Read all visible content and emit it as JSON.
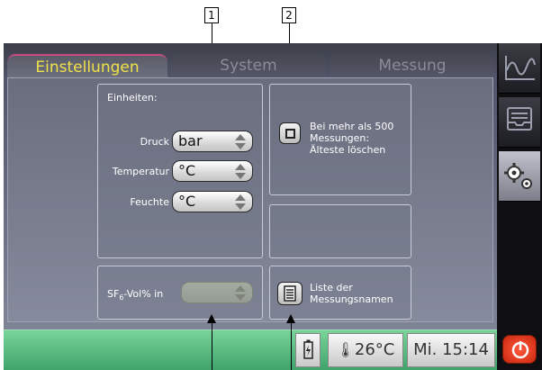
{
  "callouts": [
    "1",
    "2"
  ],
  "tabs": {
    "einstellungen": "Einstellungen",
    "system": "System",
    "messung": "Messung"
  },
  "units": {
    "heading": "Einheiten:",
    "pressure_label": "Druck",
    "pressure_value": "bar",
    "temperature_label": "Temperatur",
    "temperature_value": "°C",
    "humidity_label": "Feuchte",
    "humidity_value": "°C"
  },
  "delete_option": {
    "line1": "Bei mehr als 500",
    "line2": "Messungen:",
    "line3": "Älteste löschen"
  },
  "sf6": {
    "label_prefix": "SF",
    "label_sub": "6",
    "label_suffix": "-Vol% in",
    "value": ""
  },
  "measurement_names": {
    "line1": "Liste der",
    "line2": "Messungsnamen"
  },
  "status_bar": {
    "temperature": "26°C",
    "datetime": "Mi. 15:14"
  },
  "sidebar": {
    "icons": [
      "measurement-graph-icon",
      "tray-icon",
      "settings-gears-icon"
    ],
    "active": "settings-gears-icon"
  },
  "colors": {
    "active_tab_text": "#f0e14a",
    "status_bar": "#4fb676",
    "power_button": "#e03a1c"
  }
}
